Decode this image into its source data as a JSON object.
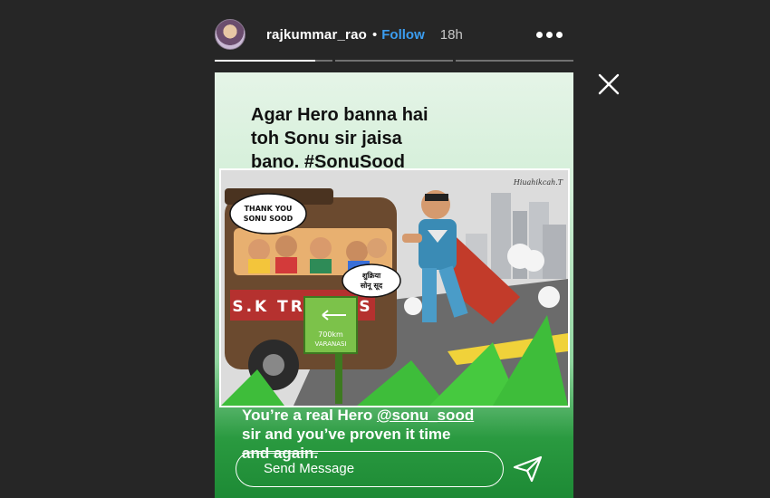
{
  "header": {
    "username": "rajkummar_rao",
    "separator": "•",
    "follow_label": "Follow",
    "time": "18h",
    "more_icon": "more-horizontal-icon",
    "avatar_icon": "profile-avatar"
  },
  "progress": {
    "segments": 3,
    "current_segment_fill": 0.85
  },
  "story": {
    "caption_top_line1": "Agar Hero banna hai",
    "caption_top_line2": "toh Sonu sir jaisa",
    "caption_top_line3_prefix": "bano. ",
    "caption_top_hashtag": "#SonuSood",
    "artwork": {
      "signature": "Hiuahikcah.T",
      "speech_bubble_1_line1": "THANK YOU",
      "speech_bubble_1_line2": "SONU SOOD",
      "speech_bubble_2_line1": "शुक्रिया",
      "speech_bubble_2_line2": "सोनू सूद",
      "bus_sign": "S.K TRAVELS",
      "road_sign_distance": "700km",
      "road_sign_city": "VARANASI"
    },
    "caption_bottom_line1_prefix": "You’re a real Hero ",
    "caption_bottom_mention": "@sonu_sood",
    "caption_bottom_line2": "sir and you’ve proven it time",
    "caption_bottom_line3": "and again."
  },
  "reply": {
    "placeholder": "Send Message",
    "send_icon": "paper-plane-icon"
  },
  "close_icon": "close-icon",
  "colors": {
    "background": "#262626",
    "follow": "#3b9df0",
    "story_top": "#e5f4e7",
    "story_bottom": "#1d8a35"
  }
}
